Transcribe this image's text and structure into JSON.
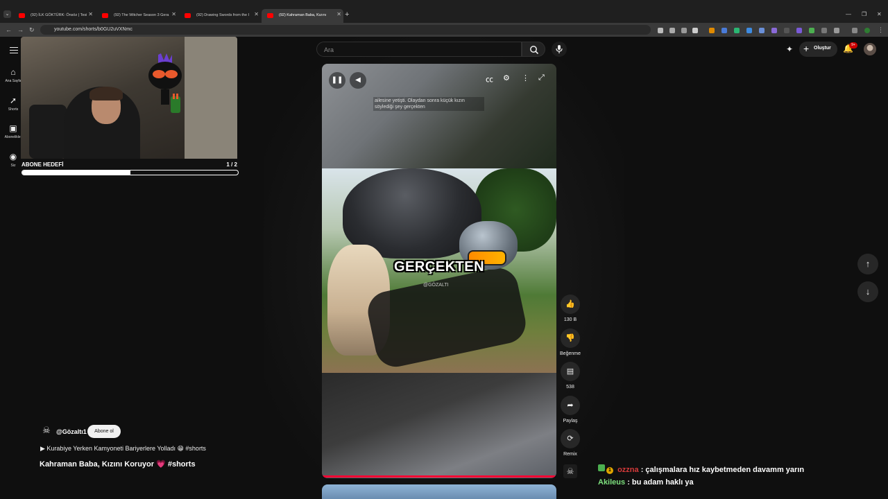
{
  "browser": {
    "tabs": [
      {
        "label": "(92) İLK GÖKTÜRK: Önsöz | Tesi",
        "active": false
      },
      {
        "label": "(92) The Witcher Season 3 Gera",
        "active": false
      },
      {
        "label": "(92) Drawing Swords from the I",
        "active": false
      },
      {
        "label": "(92) Kahraman Baba, Kızını",
        "active": true
      }
    ],
    "url": "youtube.com/shorts/b0GU2uVXNmc"
  },
  "youtube": {
    "search_placeholder": "Ara",
    "create_label": "Oluştur",
    "notification_badge": "9+",
    "sidebar": [
      {
        "label": "Ana Sayfa",
        "icon": "home-icon"
      },
      {
        "label": "Shorts",
        "icon": "shorts-icon"
      },
      {
        "label": "Abonelikler",
        "icon": "subscriptions-icon"
      },
      {
        "label": "Siz",
        "icon": "you-icon"
      }
    ]
  },
  "overlay": {
    "goal_label": "ABONE HEDEFİ",
    "goal_count": "1  / 2",
    "goal_progress_fraction": 0.5
  },
  "video": {
    "caption_top": "ailesine yetişti. Olaydan sonra küçük kızın söylediği şey gerçekten",
    "caption_big": "GERÇEKTEN",
    "watermark": "@GÖZALTI",
    "channel": "@Gözaltı1",
    "subscribe_label": "Abone ol",
    "related": "▶  Kurabiye Yerken Kamyoneti Bariyerlere Yolladı 😁 #shorts",
    "title": "Kahraman Baba, Kızını Koruyor 💗 #shorts"
  },
  "actions": {
    "like_count": "130 B",
    "dislike_label": "Beğenme",
    "comment_count": "538",
    "share_label": "Paylaş",
    "remix_label": "Remix"
  },
  "chat": [
    {
      "user": "ozzna",
      "user_color": "#d63a3a",
      "message": ": çalışmalara hız kaybetmeden davamm yarın"
    },
    {
      "user": "Akileus",
      "user_color": "#7ee07e",
      "message": ": bu adam haklı ya"
    }
  ]
}
